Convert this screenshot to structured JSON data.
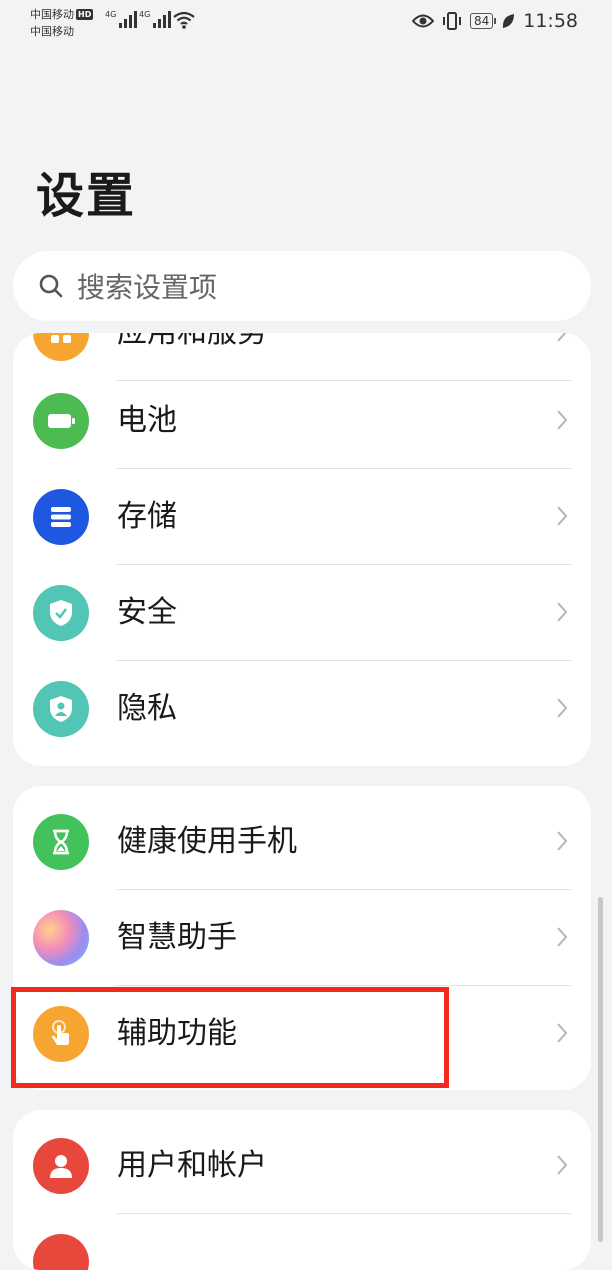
{
  "status_bar": {
    "carrier1": "中国移动",
    "hd_badge": "HD",
    "carrier2": "中国移动",
    "net1": "4G",
    "net2": "4G",
    "battery": "84",
    "time": "11:58"
  },
  "page_title": "设置",
  "search": {
    "placeholder": "搜索设置项"
  },
  "group1": {
    "items": [
      {
        "label": "应用和服务",
        "icon": "apps-icon",
        "color": "#f7a531"
      },
      {
        "label": "电池",
        "icon": "battery-icon",
        "color": "#4cbb52"
      },
      {
        "label": "存储",
        "icon": "storage-icon",
        "color": "#1f58e0"
      },
      {
        "label": "安全",
        "icon": "shield-check-icon",
        "color": "#52c5b4"
      },
      {
        "label": "隐私",
        "icon": "privacy-shield-icon",
        "color": "#52c5b4"
      }
    ]
  },
  "group2": {
    "items": [
      {
        "label": "健康使用手机",
        "icon": "hourglass-icon",
        "color": "#43c25c"
      },
      {
        "label": "智慧助手",
        "icon": "assistant-icon",
        "color": "#b78fe8"
      },
      {
        "label": "辅助功能",
        "icon": "tap-hand-icon",
        "color": "#f7a531"
      }
    ]
  },
  "group3": {
    "items": [
      {
        "label": "用户和帐户",
        "icon": "user-icon",
        "color": "#e8473b"
      }
    ]
  },
  "accent_highlight": "#f02a1e"
}
